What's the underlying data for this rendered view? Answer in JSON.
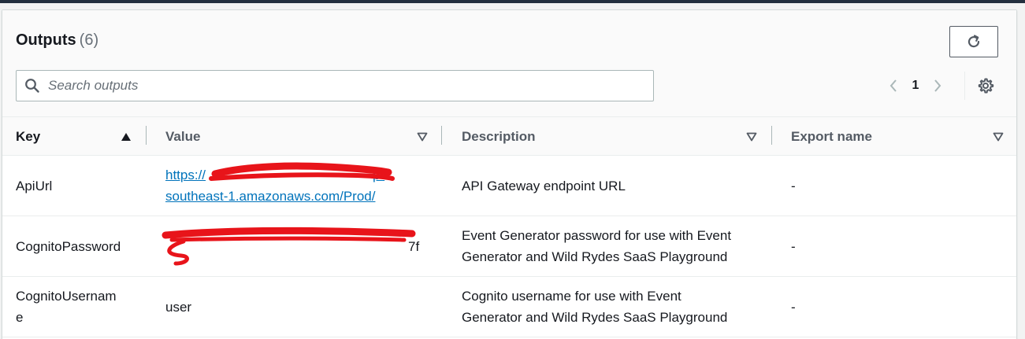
{
  "panel": {
    "title": "Outputs",
    "count": "(6)"
  },
  "search": {
    "placeholder": "Search outputs",
    "value": ""
  },
  "pagination": {
    "current_page": "1"
  },
  "icons": {
    "refresh": "refresh-icon",
    "search": "search-icon",
    "prev": "chevron-left-icon",
    "next": "chevron-right-icon",
    "settings": "gear-icon",
    "sort_asc": "caret-up-icon",
    "sort_none": "caret-down-outline-icon"
  },
  "table": {
    "columns": [
      "Key",
      "Value",
      "Description",
      "Export name"
    ],
    "rows": [
      {
        "key": "ApiUrl",
        "value_line1": "https://",
        "value_line1_tail": "p-",
        "value_line2": "southeast-1.amazonaws.com/Prod/",
        "description": "API Gateway endpoint URL",
        "export_name": "-"
      },
      {
        "key": "CognitoPassword",
        "value_tail": "7f",
        "description_line1": "Event Generator password for use with Event",
        "description_line2": "Generator and Wild Rydes SaaS Playground",
        "export_name": "-"
      },
      {
        "key_line1": "CognitoUsernam",
        "key_line2": "e",
        "value": "user",
        "description_line1": "Cognito username for use with Event",
        "description_line2": "Generator and Wild Rydes SaaS Playground",
        "export_name": "-"
      }
    ]
  },
  "colors": {
    "link": "#0073bb",
    "redaction": "#e8141a",
    "header_bg": "#fafafa",
    "text_primary": "#16191f",
    "text_secondary": "#545b64"
  }
}
